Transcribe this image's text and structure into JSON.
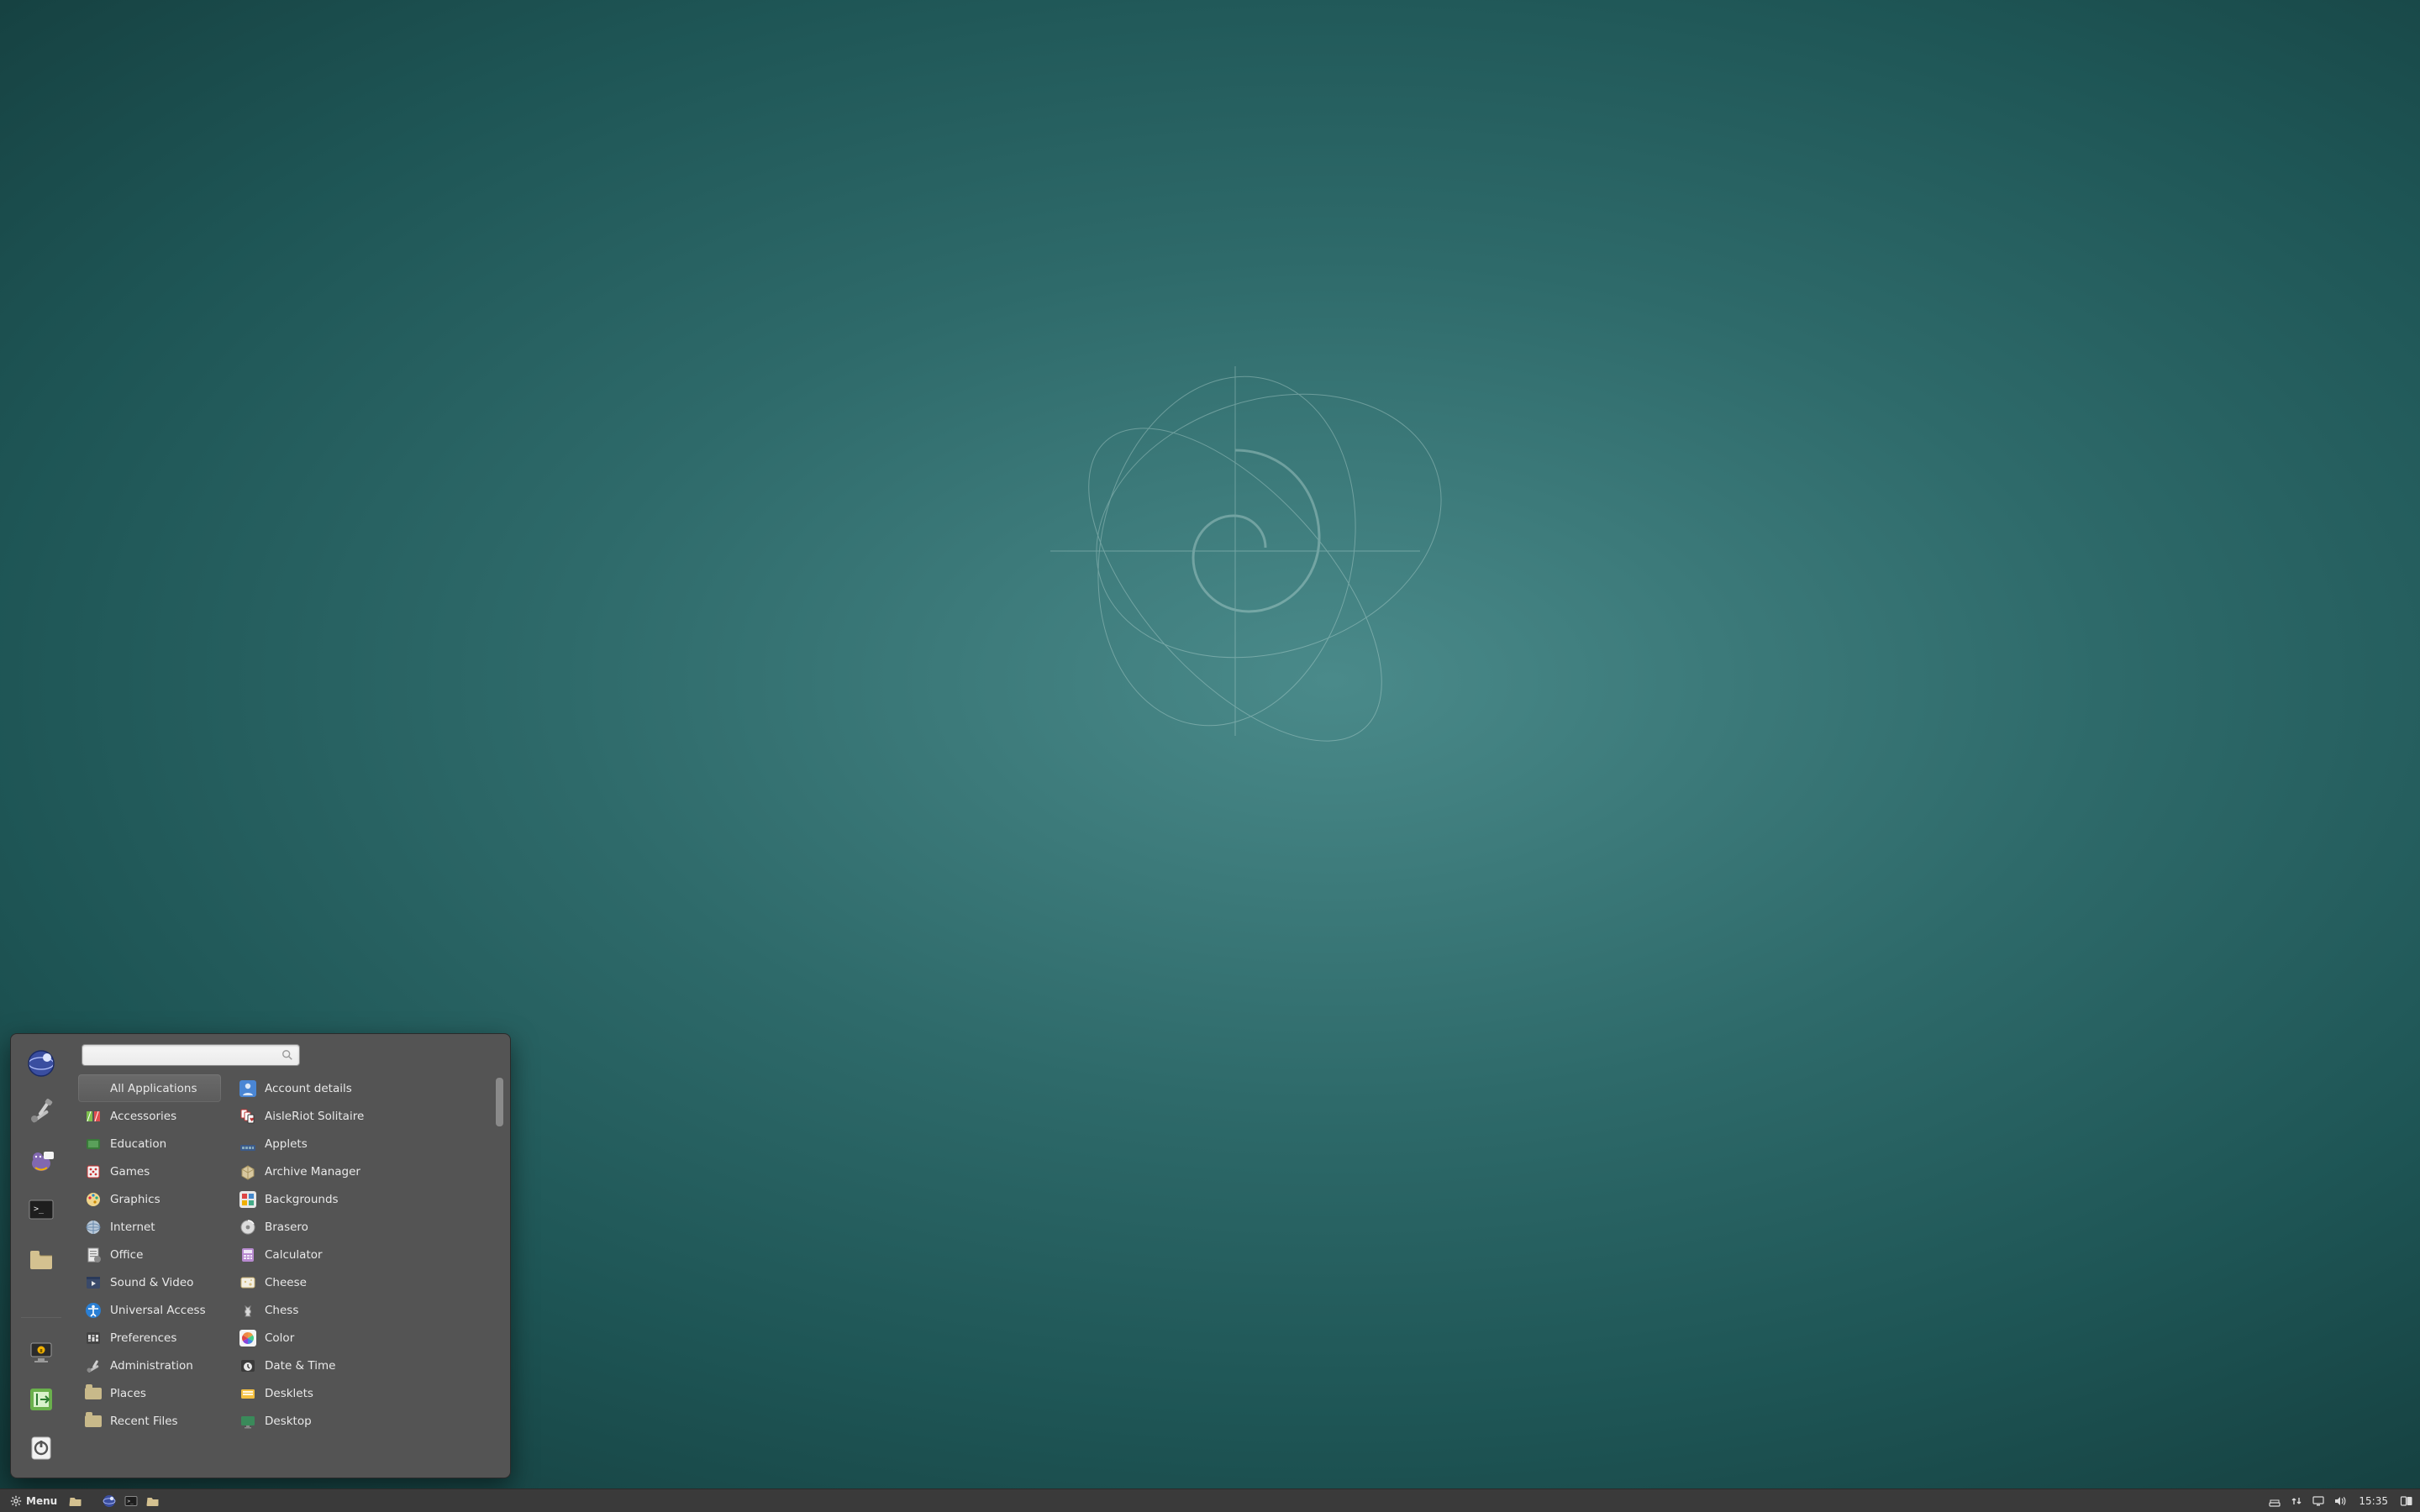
{
  "taskbar": {
    "menu_label": "Menu",
    "clock": "15:35",
    "launchers": [
      {
        "name": "files-launcher",
        "icon": "folder-icon"
      },
      {
        "name": "web-browser-launcher",
        "icon": "globe-icon"
      },
      {
        "name": "terminal-launcher",
        "icon": "terminal-icon"
      },
      {
        "name": "file-manager-launcher",
        "icon": "folder-icon"
      }
    ],
    "tray": [
      {
        "name": "tray-applet-icon",
        "icon": "tray-dash-icon"
      },
      {
        "name": "network-icon",
        "icon": "network-arrows-icon"
      },
      {
        "name": "display-icon",
        "icon": "display-icon"
      },
      {
        "name": "volume-icon",
        "icon": "volume-icon"
      }
    ],
    "workspace_switcher": {
      "name": "workspace-switcher",
      "icon": "workspace-icon"
    }
  },
  "menu": {
    "search_placeholder": "",
    "favorites": [
      {
        "name": "favorite-web-browser",
        "icon": "globe-icon"
      },
      {
        "name": "favorite-system-settings",
        "icon": "tools-icon"
      },
      {
        "name": "favorite-messaging",
        "icon": "pidgin-icon"
      },
      {
        "name": "favorite-terminal",
        "icon": "terminal-icon"
      },
      {
        "name": "favorite-files",
        "icon": "folder-icon"
      }
    ],
    "system_buttons": [
      {
        "name": "lock-screen-button",
        "icon": "lock-screen-icon"
      },
      {
        "name": "logout-button",
        "icon": "logout-icon"
      },
      {
        "name": "shutdown-button",
        "icon": "shutdown-icon"
      }
    ],
    "categories": [
      {
        "label": "All Applications",
        "icon": "all-apps-icon",
        "selected": true
      },
      {
        "label": "Accessories",
        "icon": "accessories-icon"
      },
      {
        "label": "Education",
        "icon": "education-icon"
      },
      {
        "label": "Games",
        "icon": "games-icon"
      },
      {
        "label": "Graphics",
        "icon": "graphics-icon"
      },
      {
        "label": "Internet",
        "icon": "internet-icon"
      },
      {
        "label": "Office",
        "icon": "office-icon"
      },
      {
        "label": "Sound & Video",
        "icon": "sound-video-icon"
      },
      {
        "label": "Universal Access",
        "icon": "universal-access-icon"
      },
      {
        "label": "Preferences",
        "icon": "preferences-icon"
      },
      {
        "label": "Administration",
        "icon": "administration-icon"
      },
      {
        "label": "Places",
        "icon": "places-icon"
      },
      {
        "label": "Recent Files",
        "icon": "recent-files-icon"
      }
    ],
    "applications": [
      {
        "label": "Account details",
        "icon": "account-details-icon"
      },
      {
        "label": "AisleRiot Solitaire",
        "icon": "solitaire-icon"
      },
      {
        "label": "Applets",
        "icon": "applets-icon"
      },
      {
        "label": "Archive Manager",
        "icon": "archive-manager-icon"
      },
      {
        "label": "Backgrounds",
        "icon": "backgrounds-icon"
      },
      {
        "label": "Brasero",
        "icon": "brasero-icon"
      },
      {
        "label": "Calculator",
        "icon": "calculator-icon"
      },
      {
        "label": "Cheese",
        "icon": "cheese-icon"
      },
      {
        "label": "Chess",
        "icon": "chess-icon"
      },
      {
        "label": "Color",
        "icon": "color-icon"
      },
      {
        "label": "Date & Time",
        "icon": "date-time-icon"
      },
      {
        "label": "Desklets",
        "icon": "desklets-icon"
      },
      {
        "label": "Desktop",
        "icon": "desktop-icon"
      }
    ]
  }
}
